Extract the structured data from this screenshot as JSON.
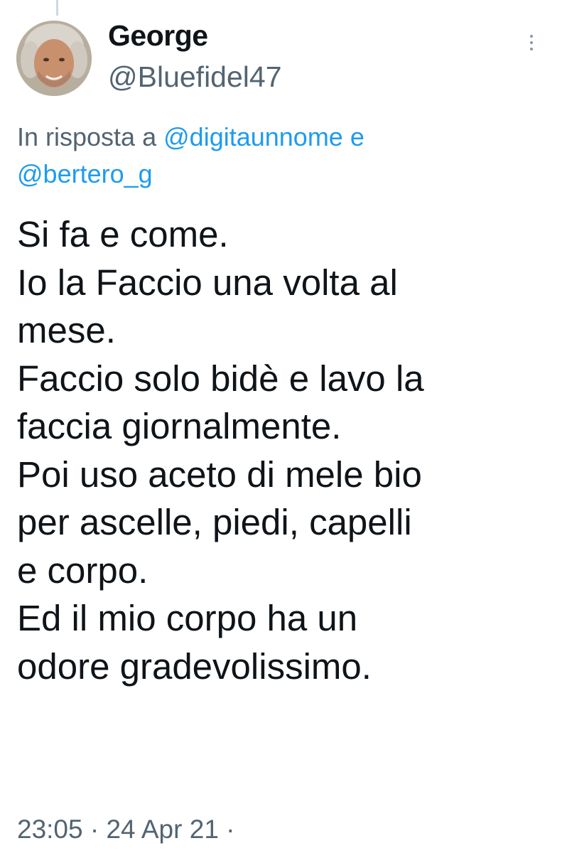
{
  "tweet": {
    "author": {
      "display_name": "George",
      "handle": "@Bluefidel47",
      "avatar_icon": "profile-photo"
    },
    "reply_to": {
      "prefix": "In risposta a",
      "mention_1": "@digitaunnome",
      "conjunction": "e",
      "mention_2": "@bertero_g"
    },
    "text_lines": [
      "Si fa e come.",
      "Io la Faccio una volta al",
      "mese.",
      "Faccio solo bidè e lavo la",
      "faccia giornalmente.",
      "Poi uso aceto di mele bio",
      "per ascelle, piedi, capelli",
      "e corpo.",
      "Ed il mio corpo ha un",
      "odore gradevolissimo."
    ],
    "timestamp": {
      "time": "23:05",
      "separator": "·",
      "date": "24 Apr 21",
      "trailing": "·"
    },
    "more_icon": "more-vertical-icon"
  },
  "colors": {
    "text_primary": "#0f1419",
    "text_secondary": "#536471",
    "mention": "#1d9bf0",
    "background": "#ffffff"
  }
}
